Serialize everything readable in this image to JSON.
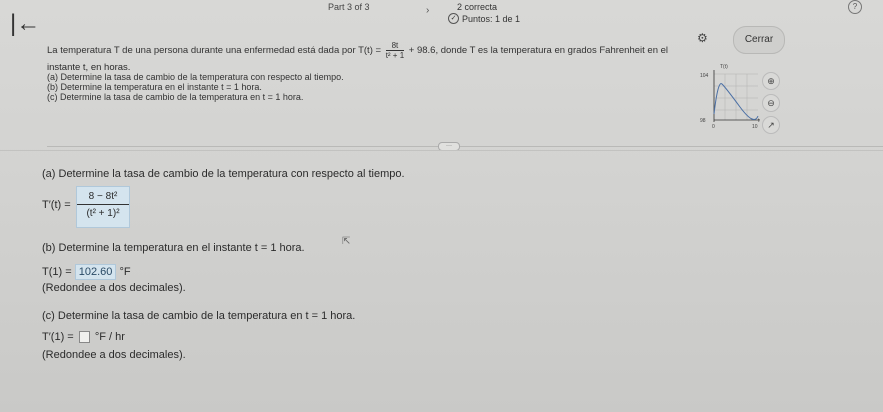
{
  "header": {
    "part": "Part 3 of 3",
    "status": "2 correcta",
    "points": "Puntos: 1 de 1",
    "close_label": "Cerrar"
  },
  "problem": {
    "intro": "La temperatura T de una persona durante una enfermedad está dada por T(t) =",
    "numerator": "8t",
    "denominator": "t² + 1",
    "rest": "+ 98.6, donde T es la temperatura en grados Fahrenheit en el",
    "line2": "instante t, en horas.",
    "task_a": "(a) Determine la tasa de cambio de la temperatura con respecto al tiempo.",
    "task_b": "(b) Determine la temperatura en el instante t = 1 hora.",
    "task_c": "(c) Determine la tasa de cambio de la temperatura en t = 1 hora."
  },
  "graph": {
    "y_top": "104",
    "y_bottom": "98",
    "x_left": "0",
    "x_right": "10",
    "y_axis_label": "T(t)",
    "x_axis_label": "t"
  },
  "part_a": {
    "question": "(a) Determine la tasa de cambio de la temperatura con respecto al tiempo.",
    "lhs": "T′(t) =",
    "numerator": "8 − 8t²",
    "denominator": "(t² + 1)²"
  },
  "part_b": {
    "question": "(b) Determine la temperatura en el instante t = 1 hora.",
    "lhs": "T(1) =",
    "answer": "102.60",
    "unit": "°F",
    "note": "(Redondee a dos decimales)."
  },
  "part_c": {
    "question": "(c) Determine la tasa de cambio de la temperatura en t = 1 hora.",
    "lhs": "T′(1) =",
    "answer": "",
    "unit": "°F / hr",
    "note": "(Redondee a dos decimales)."
  },
  "icons": [
    "back-arrow-icon",
    "check-circle-icon",
    "help-icon",
    "gear-icon",
    "zoom-in-icon",
    "zoom-out-icon",
    "external-link-icon",
    "cursor-icon"
  ]
}
